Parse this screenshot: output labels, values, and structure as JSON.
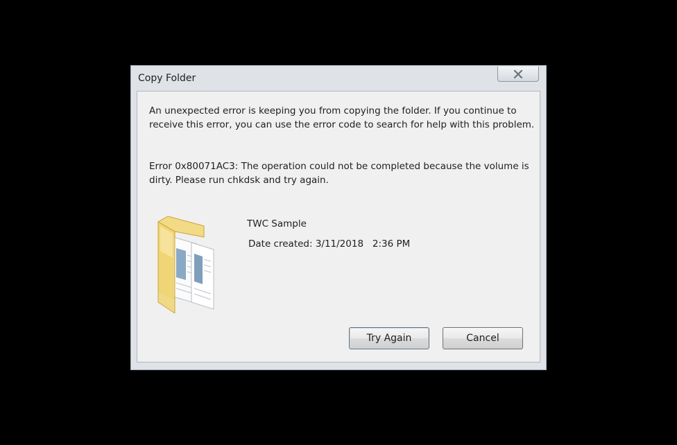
{
  "dialog": {
    "title": "Copy Folder",
    "message": "An unexpected error is keeping you from copying the folder. If you continue to receive this error, you can use the error code to search for help with this problem.",
    "error": "Error 0x80071AC3: The operation could not be completed because the volume is dirty. Please run chkdsk and try again.",
    "file_name": "TWC Sample",
    "date_created": "Date created: 3/11/2018   2:36 PM",
    "try_again_label": "Try Again",
    "cancel_label": "Cancel"
  },
  "icons": {
    "close": "close-icon",
    "folder": "folder-icon"
  },
  "colors": {
    "backdrop": "#000000",
    "dialog_frame": "#dfe3e8",
    "content_bg": "#f0f0f0",
    "folder_yellow": "#f1d77a"
  }
}
